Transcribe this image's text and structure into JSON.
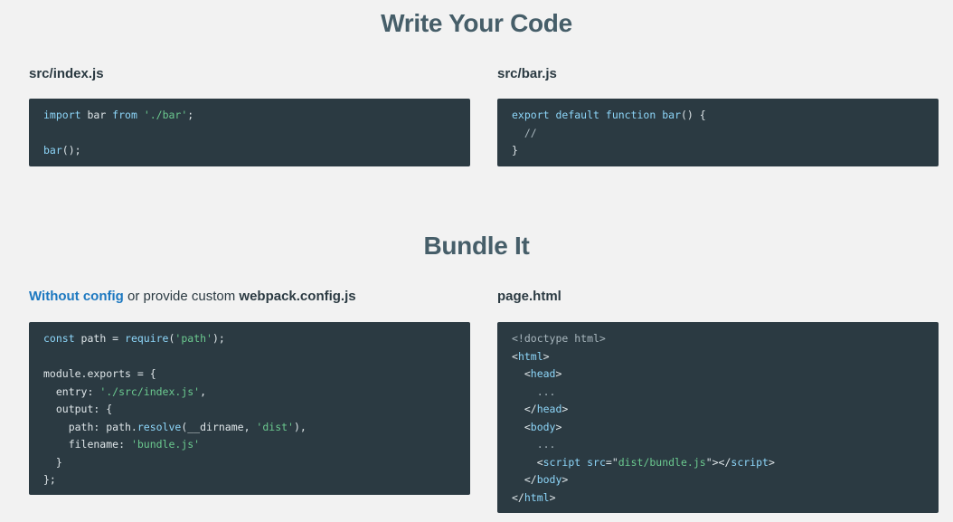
{
  "section1": {
    "title": "Write Your Code",
    "left_label": "src/index.js",
    "right_label": "src/bar.js",
    "left_code": [
      [
        {
          "t": "import",
          "c": "kw"
        },
        {
          "t": " bar ",
          "c": "pl"
        },
        {
          "t": "from",
          "c": "kw"
        },
        {
          "t": " ",
          "c": "pl"
        },
        {
          "t": "'./bar'",
          "c": "str"
        },
        {
          "t": ";",
          "c": "pl"
        }
      ],
      [],
      [
        {
          "t": "bar",
          "c": "fn"
        },
        {
          "t": "();",
          "c": "pl"
        }
      ]
    ],
    "right_code": [
      [
        {
          "t": "export",
          "c": "kw"
        },
        {
          "t": " ",
          "c": "pl"
        },
        {
          "t": "default",
          "c": "kw"
        },
        {
          "t": " ",
          "c": "pl"
        },
        {
          "t": "function",
          "c": "kw"
        },
        {
          "t": " ",
          "c": "pl"
        },
        {
          "t": "bar",
          "c": "fn"
        },
        {
          "t": "() {",
          "c": "pl"
        }
      ],
      [
        {
          "t": "  //",
          "c": "cm"
        }
      ],
      [
        {
          "t": "}",
          "c": "pl"
        }
      ]
    ]
  },
  "section2": {
    "title": "Bundle It",
    "left_label_link": "Without config",
    "left_label_middle": " or provide custom ",
    "left_label_bold": "webpack.config.js",
    "right_label": "page.html",
    "left_code": [
      [
        {
          "t": "const",
          "c": "kw"
        },
        {
          "t": " path = ",
          "c": "pl"
        },
        {
          "t": "require",
          "c": "fn"
        },
        {
          "t": "(",
          "c": "pl"
        },
        {
          "t": "'path'",
          "c": "str"
        },
        {
          "t": ");",
          "c": "pl"
        }
      ],
      [],
      [
        {
          "t": "module.exports = {",
          "c": "pl"
        }
      ],
      [
        {
          "t": "  entry: ",
          "c": "pl"
        },
        {
          "t": "'./src/index.js'",
          "c": "str"
        },
        {
          "t": ",",
          "c": "pl"
        }
      ],
      [
        {
          "t": "  output: {",
          "c": "pl"
        }
      ],
      [
        {
          "t": "    path: path.",
          "c": "pl"
        },
        {
          "t": "resolve",
          "c": "fn"
        },
        {
          "t": "(__dirname, ",
          "c": "pl"
        },
        {
          "t": "'dist'",
          "c": "str"
        },
        {
          "t": "),",
          "c": "pl"
        }
      ],
      [
        {
          "t": "    filename: ",
          "c": "pl"
        },
        {
          "t": "'bundle.js'",
          "c": "str"
        }
      ],
      [
        {
          "t": "  }",
          "c": "pl"
        }
      ],
      [
        {
          "t": "};",
          "c": "pl"
        }
      ]
    ],
    "right_code": [
      [
        {
          "t": "<!doctype html>",
          "c": "cm"
        }
      ],
      [
        {
          "t": "<",
          "c": "pl"
        },
        {
          "t": "html",
          "c": "kw"
        },
        {
          "t": ">",
          "c": "pl"
        }
      ],
      [
        {
          "t": "  <",
          "c": "pl"
        },
        {
          "t": "head",
          "c": "kw"
        },
        {
          "t": ">",
          "c": "pl"
        }
      ],
      [
        {
          "t": "    ...",
          "c": "cm"
        }
      ],
      [
        {
          "t": "  </",
          "c": "pl"
        },
        {
          "t": "head",
          "c": "kw"
        },
        {
          "t": ">",
          "c": "pl"
        }
      ],
      [
        {
          "t": "  <",
          "c": "pl"
        },
        {
          "t": "body",
          "c": "kw"
        },
        {
          "t": ">",
          "c": "pl"
        }
      ],
      [
        {
          "t": "    ...",
          "c": "cm"
        }
      ],
      [
        {
          "t": "    <",
          "c": "pl"
        },
        {
          "t": "script",
          "c": "kw"
        },
        {
          "t": " ",
          "c": "pl"
        },
        {
          "t": "src",
          "c": "kw"
        },
        {
          "t": "=\"",
          "c": "pl"
        },
        {
          "t": "dist/bundle.js",
          "c": "str"
        },
        {
          "t": "\"></",
          "c": "pl"
        },
        {
          "t": "script",
          "c": "kw"
        },
        {
          "t": ">",
          "c": "pl"
        }
      ],
      [
        {
          "t": "  </",
          "c": "pl"
        },
        {
          "t": "body",
          "c": "kw"
        },
        {
          "t": ">",
          "c": "pl"
        }
      ],
      [
        {
          "t": "</",
          "c": "pl"
        },
        {
          "t": "html",
          "c": "kw"
        },
        {
          "t": ">",
          "c": "pl"
        }
      ]
    ]
  },
  "colors": {
    "background": "#f2f2f2",
    "title": "#465e69",
    "code_background": "#2b3a42",
    "keyword": "#8dd6f9",
    "string": "#6bc98f",
    "comment": "#a8b6bd",
    "link": "#1c78c0"
  }
}
